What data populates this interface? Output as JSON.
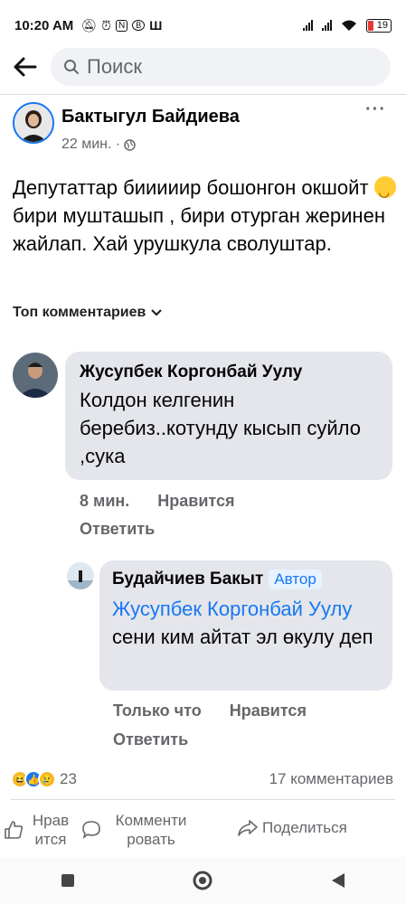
{
  "status": {
    "time": "10:20 AM",
    "battery": "19"
  },
  "search": {
    "placeholder": "Поиск"
  },
  "post": {
    "author": "Бактыгул Байдиева",
    "time": "22 мин. ·",
    "text_part1": "Депутаттар бииииир бошонгон окшойт",
    "text_part2": "бири мушташып , бири отурган жеринен жайлап. Хай урушкула сволуштар.",
    "more": "···"
  },
  "sort_label": "Топ комментариев",
  "comments": [
    {
      "name": "Жусупбек Коргонбай Уулу",
      "text": "Колдон келгенин беребиз..котунду кысып суйло ,сука",
      "time": "8 мин.",
      "like": "Нравится",
      "reply": "Ответить"
    },
    {
      "name": "Будайчиев Бакыт",
      "badge": "Автор",
      "mention": "Жусупбек Коргонбай Уулу",
      "text": "сени ким айтат эл өкулу деп",
      "time": "Только что",
      "like": "Нравится",
      "reply": "Ответить"
    }
  ],
  "reactions": {
    "count": "23"
  },
  "comment_count": "17 комментариев",
  "actions": {
    "like": "Нрав итcя",
    "comment": "Комменти ровать",
    "share": "Поделиться"
  }
}
